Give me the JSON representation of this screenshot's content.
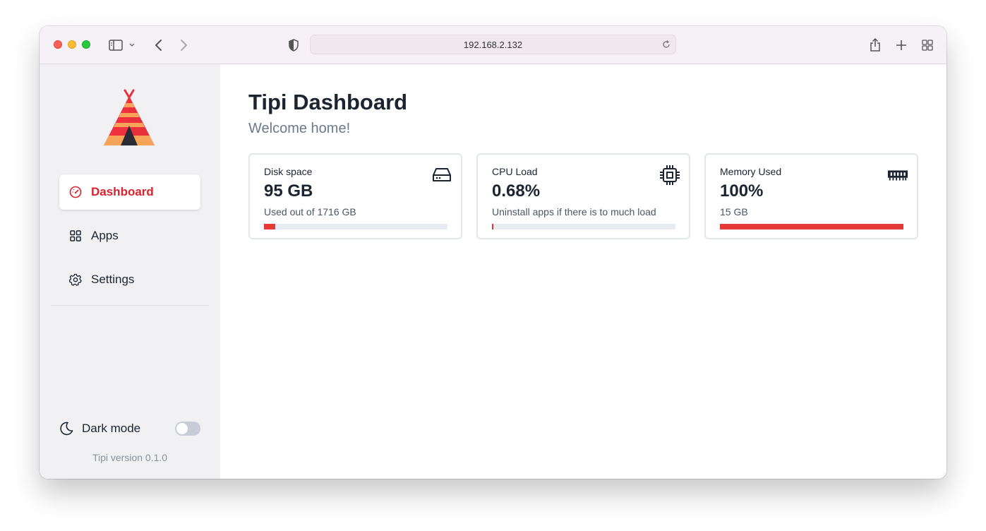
{
  "browser": {
    "url": "192.168.2.132"
  },
  "sidebar": {
    "nav": [
      {
        "label": "Dashboard",
        "icon": "gauge-icon",
        "active": true
      },
      {
        "label": "Apps",
        "icon": "grid-icon",
        "active": false
      },
      {
        "label": "Settings",
        "icon": "gear-icon",
        "active": false
      }
    ],
    "dark_mode_label": "Dark mode",
    "dark_mode_on": false,
    "version": "Tipi version 0.1.0"
  },
  "main": {
    "title": "Tipi Dashboard",
    "subtitle": "Welcome home!",
    "cards": [
      {
        "title": "Disk space",
        "value": "95 GB",
        "sub": "Used out of 1716 GB",
        "icon": "hard-drive-icon",
        "progress": 0.06
      },
      {
        "title": "CPU Load",
        "value": "0.68%",
        "sub": "Uninstall apps if there is to much load",
        "icon": "cpu-icon",
        "progress": 0.0068
      },
      {
        "title": "Memory Used",
        "value": "100%",
        "sub": "15 GB",
        "icon": "memory-icon",
        "progress": 1.0
      }
    ]
  },
  "colors": {
    "accent": "#d6232e",
    "progress_fill": "#e63838",
    "progress_track": "#e8ecf2"
  }
}
